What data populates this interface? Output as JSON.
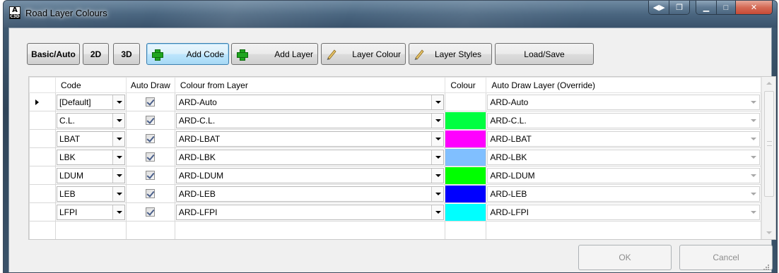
{
  "window": {
    "title": "Road Layer Colours",
    "app_icon_letter": "A",
    "app_icon_sub": "C3D",
    "controls": [
      "restore-nav",
      "restore-window",
      "minimize",
      "maximize",
      "close"
    ]
  },
  "toolbar": {
    "basic_auto": "Basic/Auto",
    "btn_2d": "2D",
    "btn_3d": "3D",
    "add_code": "Add Code",
    "add_layer": "Add Layer",
    "layer_colour": "Layer Colour",
    "layer_styles": "Layer Styles",
    "load_save": "Load/Save"
  },
  "grid": {
    "columns": [
      "Code",
      "Auto Draw",
      "Colour from Layer",
      "Colour",
      "Auto Draw Layer (Override)"
    ],
    "rows": [
      {
        "code": "[Default]",
        "auto_draw": true,
        "layer": "ARD-Auto",
        "colour": "#ffffff",
        "override": "ARD-Auto",
        "current": true
      },
      {
        "code": "C.L.",
        "auto_draw": true,
        "layer": "ARD-C.L.",
        "colour": "#00ff40",
        "override": "ARD-C.L.",
        "current": false
      },
      {
        "code": "LBAT",
        "auto_draw": true,
        "layer": "ARD-LBAT",
        "colour": "#ff00ff",
        "override": "ARD-LBAT",
        "current": false
      },
      {
        "code": "LBK",
        "auto_draw": true,
        "layer": "ARD-LBK",
        "colour": "#80bfff",
        "override": "ARD-LBK",
        "current": false
      },
      {
        "code": "LDUM",
        "auto_draw": true,
        "layer": "ARD-LDUM",
        "colour": "#00ff00",
        "override": "ARD-LDUM",
        "current": false
      },
      {
        "code": "LEB",
        "auto_draw": true,
        "layer": "ARD-LEB",
        "colour": "#0000ff",
        "override": "ARD-LEB",
        "current": false
      },
      {
        "code": "LFPI",
        "auto_draw": true,
        "layer": "ARD-LFPI",
        "colour": "#00ffff",
        "override": "ARD-LFPI",
        "current": false
      }
    ]
  },
  "dialog": {
    "ok": "OK",
    "cancel": "Cancel"
  }
}
